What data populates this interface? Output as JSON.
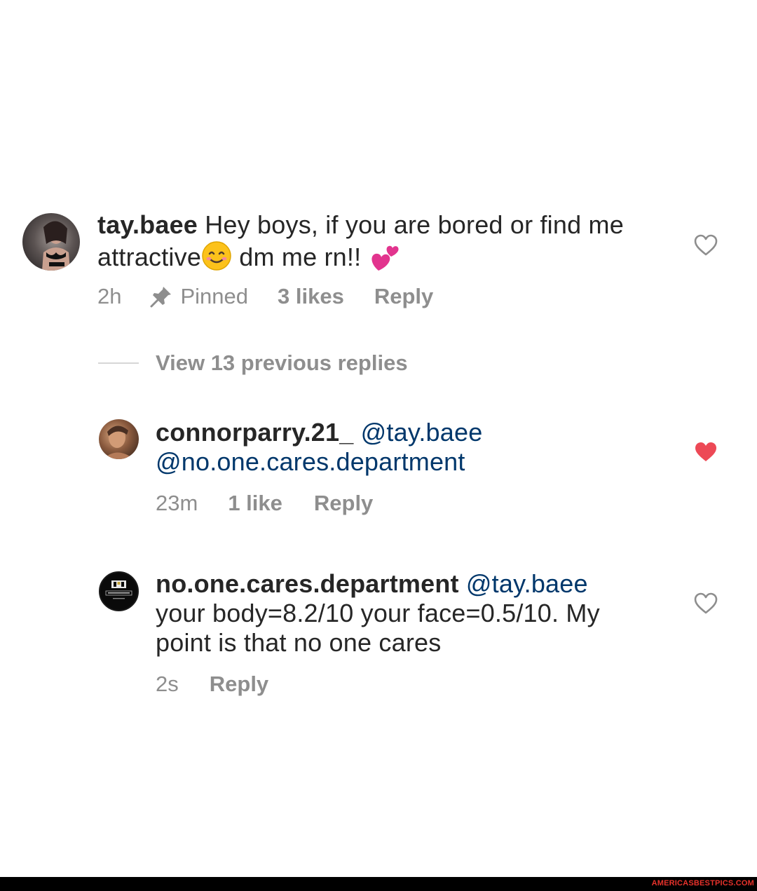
{
  "comments": [
    {
      "username": "tay.baee",
      "text_line1": " Hey boys, if you are bored or find me",
      "text_line2a": "attractive",
      "text_line2b": " dm me rn!! ",
      "time": "2h",
      "pinned_label": "Pinned",
      "likes": "3 likes",
      "reply_label": "Reply",
      "liked": false
    },
    {
      "username": "connorparry.21_",
      "mention1": "@tay.baee",
      "mention2": "@no.one.cares.department",
      "time": "23m",
      "likes": "1 like",
      "reply_label": "Reply",
      "liked": true
    },
    {
      "username": "no.one.cares.department",
      "mention1": "@tay.baee",
      "text_line2": "your body=8.2/10 your face=0.5/10. My",
      "text_line3": "point is that no one cares",
      "time": "2s",
      "reply_label": "Reply",
      "liked": false
    }
  ],
  "view_replies_label": "View 13 previous replies",
  "icons": {
    "heart_outline": "heart-outline-icon",
    "heart_filled": "heart-filled-icon",
    "pin": "pin-icon",
    "smile_emoji": "smiling-face-emoji",
    "hearts_emoji": "two-hearts-emoji"
  },
  "colors": {
    "username": "#262626",
    "mention": "#00376b",
    "meta": "#8e8e8e",
    "heart_filled": "#ed4956",
    "watermark": "#e8322b"
  },
  "watermark": "AMERICASBESTPICS.COM"
}
